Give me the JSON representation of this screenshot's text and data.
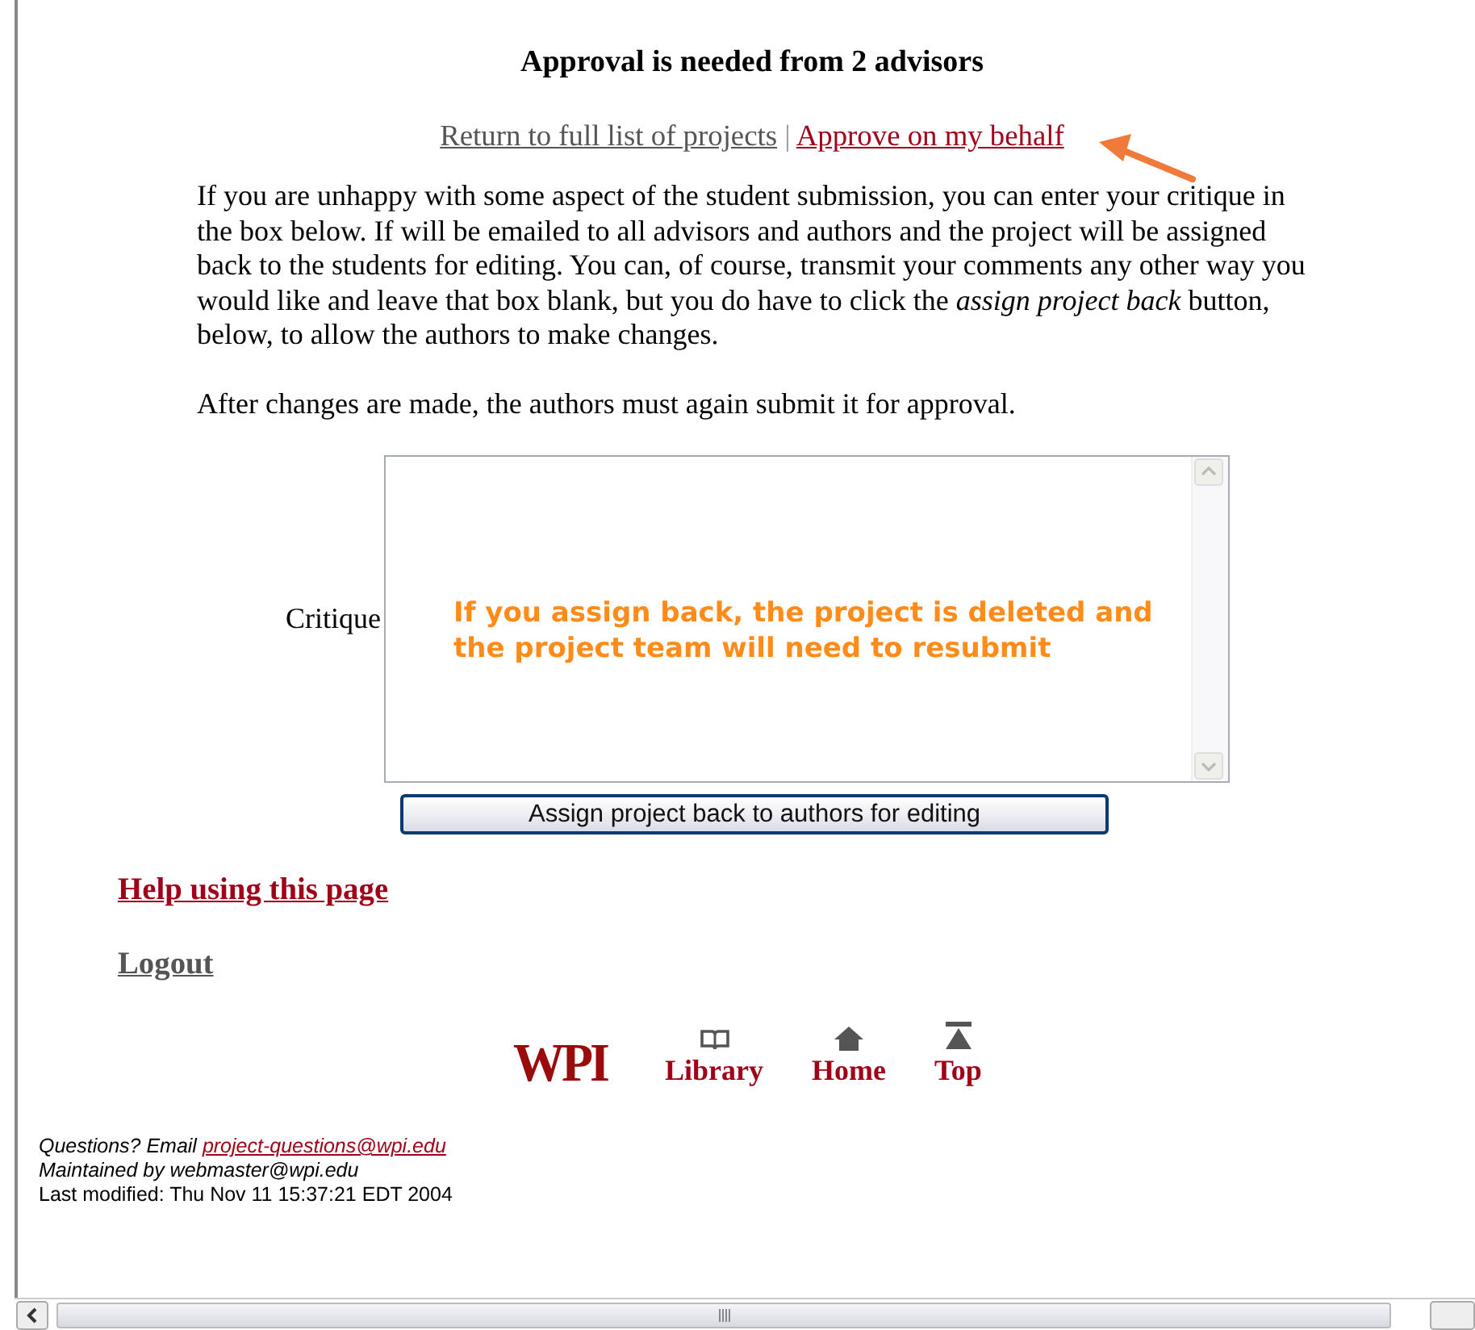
{
  "heading": "Approval is needed from 2 advisors",
  "top_links": [
    {
      "label": "Return to full list of projects",
      "kind": "visited"
    },
    {
      "label": "Approve on my behalf",
      "kind": "link"
    }
  ],
  "link_separator": "|",
  "paragraphs": [
    "If you are unhappy with some aspect of the student submission, you can enter your critique in the box below. If will be emailed to all advisors and authors and the project will be assigned back to the students for editing. You can, of course, transmit your comments any other way you would like and leave that box blank, but you do have to click the *assign project back* button, below, to allow the authors to make changes.",
    "After changes are made, the authors must again submit it for approval."
  ],
  "critique": {
    "label": "Critique",
    "annotation": "If you assign back, the project is deleted and the project team will need to resubmit"
  },
  "submit_button": "Assign project back to authors for editing",
  "bottom_links": [
    {
      "label": "Help using this page",
      "kind": "link"
    },
    {
      "label": "Logout",
      "kind": "visited"
    }
  ],
  "footer_nav": {
    "logo": "WPI",
    "items": [
      {
        "label": "Library",
        "kind": "book"
      },
      {
        "label": "Home",
        "kind": "house"
      },
      {
        "label": "Top",
        "kind": "top"
      }
    ]
  },
  "footer_lines": [
    {
      "prefix": "Questions? Email",
      "link": "project-questions@wpi.edu",
      "kind": "contact"
    },
    {
      "prefix": "Maintained by webmaster@wpi.edu",
      "kind": "contact"
    },
    {
      "prefix": "Last modified: Thu Nov 11 15:37:21 EDT 2004",
      "kind": "timestamp"
    }
  ]
}
